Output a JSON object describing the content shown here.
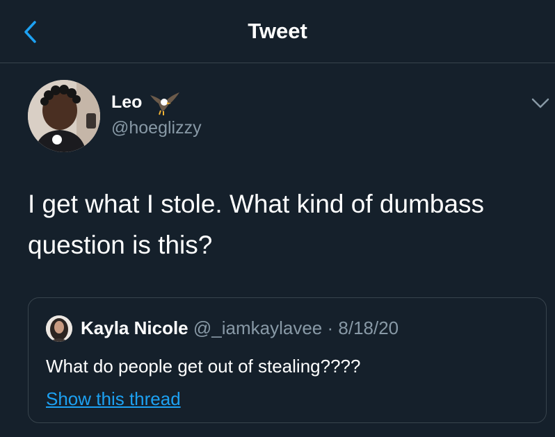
{
  "header": {
    "title": "Tweet"
  },
  "tweet": {
    "display_name": "Leo",
    "handle": "@hoeglizzy",
    "text_line1": "I get what I stole. What kind of dumbass",
    "text_line2": "question is this?"
  },
  "quote": {
    "display_name": "Kayla Nicole",
    "handle": "@_iamkaylavee",
    "separator": "·",
    "date": "8/18/20",
    "text": "What do people get out of stealing????",
    "show_thread": "Show this thread"
  },
  "icons": {
    "back": "chevron-left-icon",
    "more": "chevron-down-icon",
    "name_emoji": "eagle-emoji"
  },
  "colors": {
    "background": "#15202b",
    "border": "#38444d",
    "accent": "#1da1f2",
    "secondary_text": "#8899a6",
    "primary_text": "#ffffff"
  }
}
